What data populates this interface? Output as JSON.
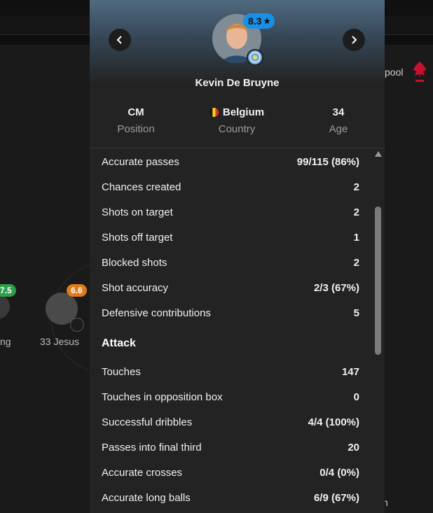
{
  "background": {
    "players": [
      {
        "rating": "7.5",
        "name": "ng"
      },
      {
        "rating": "6.6",
        "name": "33 Jesus"
      }
    ],
    "team_text": "pool",
    "extra_char": "n"
  },
  "player": {
    "name": "Kevin De Bruyne",
    "rating": "8.3",
    "rating_icon": "star-icon",
    "club_icon": "manchester-city-crest",
    "info": [
      {
        "value": "CM",
        "label": "Position"
      },
      {
        "value": "Belgium",
        "label": "Country",
        "icon": "belgium-flag"
      },
      {
        "value": "34",
        "label": "Age"
      }
    ]
  },
  "nav": {
    "prev_icon": "chevron-left-icon",
    "next_icon": "chevron-right-icon"
  },
  "stats": [
    {
      "label": "Accurate passes",
      "value": "99/115 (86%)"
    },
    {
      "label": "Chances created",
      "value": "2"
    },
    {
      "label": "Shots on target",
      "value": "2"
    },
    {
      "label": "Shots off target",
      "value": "1"
    },
    {
      "label": "Blocked shots",
      "value": "2"
    },
    {
      "label": "Shot accuracy",
      "value": "2/3 (67%)"
    },
    {
      "label": "Defensive contributions",
      "value": "5"
    }
  ],
  "attack": {
    "title": "Attack",
    "stats": [
      {
        "label": "Touches",
        "value": "147"
      },
      {
        "label": "Touches in opposition box",
        "value": "0"
      },
      {
        "label": "Successful dribbles",
        "value": "4/4 (100%)"
      },
      {
        "label": "Passes into final third",
        "value": "20"
      },
      {
        "label": "Accurate crosses",
        "value": "0/4 (0%)"
      },
      {
        "label": "Accurate long balls",
        "value": "6/9 (67%)"
      }
    ]
  },
  "colors": {
    "rating_badge": "#1a8fe6",
    "rating_green": "#2e9f4a",
    "rating_orange": "#e07b1a",
    "accent_red": "#c8102e"
  }
}
